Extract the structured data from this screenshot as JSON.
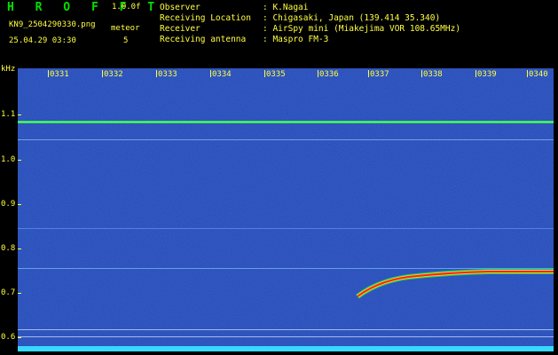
{
  "header": {
    "brand": "H R O F F T",
    "version": "1.0.0f",
    "filename": "KN9_2504290330.png",
    "meteor_label": "meteor",
    "meteor_count": "5",
    "datetime": "25.04.29 03:30"
  },
  "info": {
    "observer_label": "Observer",
    "observer_value": ": K.Nagai",
    "location_label": "Receiving Location",
    "location_value": ": Chigasaki, Japan (139.414 35.340)",
    "receiver_label": "Receiver",
    "receiver_value": ": AirSpy mini (Miakejima VOR 108.65MHz)",
    "antenna_label": "Receiving antenna",
    "antenna_value": ": Maspro FM-3"
  },
  "y_axis": {
    "unit": "kHz",
    "ticks": [
      "1.1",
      "1.0",
      "0.9",
      "0.8",
      "0.7",
      "0.6"
    ]
  },
  "x_axis": {
    "ticks": [
      "0331",
      "0332",
      "0333",
      "0334",
      "0335",
      "0336",
      "0337",
      "0338",
      "0339",
      "0340"
    ]
  },
  "colors": {
    "background": "#0a1a96",
    "signal_line": "#00ff66",
    "meteor_trail": "#ff2020",
    "text": "#ffff40"
  }
}
